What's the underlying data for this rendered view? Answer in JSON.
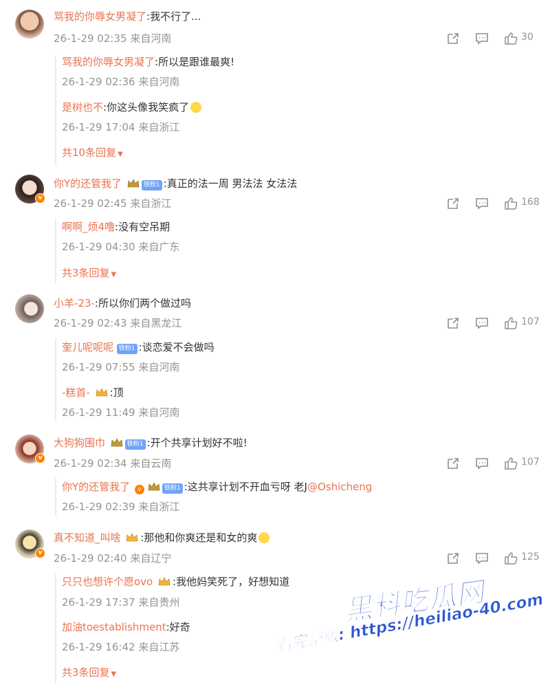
{
  "comments": [
    {
      "user": "骂我的你辱女男凝了",
      "text": "我不行了...",
      "time": "26-1-29 02:35",
      "location": "来自河南",
      "likes": "30",
      "replies": [
        {
          "user": "骂我的你辱女男凝了",
          "text": "所以是跟谁最爽!",
          "time": "26-1-29 02:36",
          "location": "来自河南"
        },
        {
          "user": "是树也不",
          "text": "你这头像我笑疯了",
          "time": "26-1-29 17:04",
          "location": "来自浙江"
        }
      ],
      "more": "共10条回复"
    },
    {
      "user": "你Y的还管我了",
      "badge": "铁粉1",
      "text": "真正的法一周 男法法 女法法",
      "time": "26-1-29 02:45",
      "location": "来自浙江",
      "likes": "168",
      "replies": [
        {
          "user": "啊啊_烦4噜",
          "text": "没有空吊期",
          "time": "26-1-29 04:30",
          "location": "来自广东"
        }
      ],
      "more": "共3条回复"
    },
    {
      "user": "小羊-23-",
      "text": "所以你们两个做过吗",
      "time": "26-1-29 02:43",
      "location": "来自黑龙江",
      "likes": "107",
      "replies": [
        {
          "user": "奎儿呢呢呢",
          "badge": "铁粉1",
          "text": "谈恋爱不会做吗",
          "time": "26-1-29 07:55",
          "location": "来自河南"
        },
        {
          "user": "-糕首-",
          "text": "顶",
          "time": "26-1-29 11:49",
          "location": "来自河南"
        }
      ]
    },
    {
      "user": "大狗狗围巾",
      "badge": "铁粉1",
      "text": "开个共享计划好不啦!",
      "time": "26-1-29 02:34",
      "location": "来自云南",
      "likes": "107",
      "replies": [
        {
          "user": "你Y的还管我了",
          "badge": "铁粉1",
          "text": "这共享计划不开血亏呀 老J",
          "mention": "@Oshicheng",
          "time": "26-1-29 02:39",
          "location": "来自浙江"
        }
      ]
    },
    {
      "user": "真不知道_叫啥",
      "text": "那他和你爽还是和女的爽",
      "time": "26-1-29 02:40",
      "location": "来自辽宁",
      "likes": "125",
      "replies": [
        {
          "user": "只只也想许个愿ovo",
          "text": "我他妈笑死了，好想知道",
          "time": "26-1-29 17:37",
          "location": "来自贵州"
        },
        {
          "user": "加油toestablishment",
          "text": "好奇",
          "time": "26-1-29 16:42",
          "location": "来自江苏"
        }
      ],
      "more": "共3条回复"
    }
  ],
  "watermark": {
    "title": "黑料吃瓜网",
    "line": "看完整版: https://heiliao-40.com"
  },
  "colors": {
    "username": "#eb7350",
    "meta": "#939393",
    "text": "#333333",
    "badge": "#6fa3f7",
    "watermark": "#2f55d4"
  },
  "icons": [
    "share-icon",
    "comment-icon",
    "like-icon",
    "crown-icon",
    "verified-icon",
    "caret-down-icon"
  ]
}
